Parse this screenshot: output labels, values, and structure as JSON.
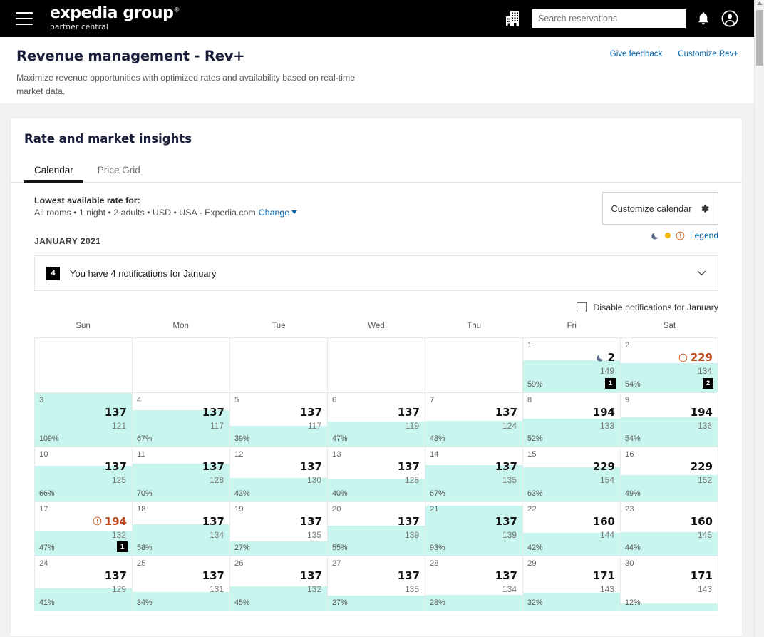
{
  "topnav": {
    "menu_icon": "hamburger-icon",
    "brand_main": "expedia group",
    "brand_reg": "®",
    "brand_sub": "partner central",
    "hotel_icon": "building-icon",
    "search_placeholder": "Search reservations",
    "search_value": "",
    "bell_icon": "bell-icon",
    "account_icon": "account-circle-icon"
  },
  "page": {
    "title": "Revenue management - Rev+",
    "subtitle": "Maximize revenue opportunities with optimized rates and availability based on real-time market data.",
    "give_feedback": "Give feedback",
    "customize_rev": "Customize Rev+"
  },
  "card": {
    "title": "Rate and market insights",
    "tabs": [
      {
        "label": "Calendar",
        "active": true
      },
      {
        "label": "Price Grid",
        "active": false
      }
    ],
    "rate_label": "Lowest available rate for:",
    "rate_value": "All rooms • 1 night • 2 adults • USD • USA - Expedia.com",
    "rate_change": "Change",
    "customize_calendar": "Customize calendar",
    "gear_icon": "gear-icon",
    "legend": {
      "moon_icon": "moon-icon",
      "dot_icon": "yellow-dot-icon",
      "warning_icon": "warning-circle-icon",
      "label": "Legend"
    }
  },
  "calendar": {
    "month_label": "JANUARY 2021",
    "notification": {
      "count": "4",
      "text": "You have 4 notifications for January",
      "chevron_icon": "chevron-down-icon"
    },
    "disable_notifications_label": "Disable notifications for January",
    "disable_notifications_checked": false,
    "weekdays": [
      "Sun",
      "Mon",
      "Tue",
      "Wed",
      "Thu",
      "Fri",
      "Sat"
    ],
    "accent_teal": "#c9f5ef",
    "alert_orange": "#c0461b",
    "cells": [
      {
        "empty": true
      },
      {
        "empty": true
      },
      {
        "empty": true
      },
      {
        "empty": true
      },
      {
        "empty": true
      },
      {
        "date": "1",
        "rate": "2",
        "market": "149",
        "occupancy": "59%",
        "badge": "1",
        "icon": "moon",
        "alert": false
      },
      {
        "date": "2",
        "rate": "229",
        "market": "134",
        "occupancy": "54%",
        "badge": "2",
        "icon": "warn",
        "alert": true
      },
      {
        "date": "3",
        "rate": "137",
        "market": "121",
        "occupancy": "109%",
        "badge": null,
        "icon": null,
        "alert": false
      },
      {
        "date": "4",
        "rate": "137",
        "market": "117",
        "occupancy": "67%",
        "badge": null,
        "icon": null,
        "alert": false
      },
      {
        "date": "5",
        "rate": "137",
        "market": "117",
        "occupancy": "39%",
        "badge": null,
        "icon": null,
        "alert": false
      },
      {
        "date": "6",
        "rate": "137",
        "market": "119",
        "occupancy": "47%",
        "badge": null,
        "icon": null,
        "alert": false
      },
      {
        "date": "7",
        "rate": "137",
        "market": "124",
        "occupancy": "48%",
        "badge": null,
        "icon": null,
        "alert": false
      },
      {
        "date": "8",
        "rate": "194",
        "market": "133",
        "occupancy": "52%",
        "badge": null,
        "icon": null,
        "alert": false
      },
      {
        "date": "9",
        "rate": "194",
        "market": "136",
        "occupancy": "54%",
        "badge": null,
        "icon": null,
        "alert": false
      },
      {
        "date": "10",
        "rate": "137",
        "market": "125",
        "occupancy": "66%",
        "badge": null,
        "icon": null,
        "alert": false
      },
      {
        "date": "11",
        "rate": "137",
        "market": "128",
        "occupancy": "70%",
        "badge": null,
        "icon": null,
        "alert": false
      },
      {
        "date": "12",
        "rate": "137",
        "market": "130",
        "occupancy": "43%",
        "badge": null,
        "icon": null,
        "alert": false
      },
      {
        "date": "13",
        "rate": "137",
        "market": "128",
        "occupancy": "40%",
        "badge": null,
        "icon": null,
        "alert": false
      },
      {
        "date": "14",
        "rate": "137",
        "market": "135",
        "occupancy": "67%",
        "badge": null,
        "icon": null,
        "alert": false
      },
      {
        "date": "15",
        "rate": "229",
        "market": "154",
        "occupancy": "63%",
        "badge": null,
        "icon": null,
        "alert": false
      },
      {
        "date": "16",
        "rate": "229",
        "market": "152",
        "occupancy": "49%",
        "badge": null,
        "icon": null,
        "alert": false
      },
      {
        "date": "17",
        "rate": "194",
        "market": "132",
        "occupancy": "47%",
        "badge": "1",
        "icon": "warn",
        "alert": true
      },
      {
        "date": "18",
        "rate": "137",
        "market": "134",
        "occupancy": "58%",
        "badge": null,
        "icon": null,
        "alert": false
      },
      {
        "date": "19",
        "rate": "137",
        "market": "135",
        "occupancy": "27%",
        "badge": null,
        "icon": null,
        "alert": false
      },
      {
        "date": "20",
        "rate": "137",
        "market": "139",
        "occupancy": "55%",
        "badge": null,
        "icon": null,
        "alert": false
      },
      {
        "date": "21",
        "rate": "137",
        "market": "139",
        "occupancy": "93%",
        "badge": null,
        "icon": null,
        "alert": false
      },
      {
        "date": "22",
        "rate": "160",
        "market": "144",
        "occupancy": "42%",
        "badge": null,
        "icon": null,
        "alert": false
      },
      {
        "date": "23",
        "rate": "160",
        "market": "145",
        "occupancy": "44%",
        "badge": null,
        "icon": null,
        "alert": false
      },
      {
        "date": "24",
        "rate": "137",
        "market": "129",
        "occupancy": "41%",
        "badge": null,
        "icon": null,
        "alert": false
      },
      {
        "date": "25",
        "rate": "137",
        "market": "131",
        "occupancy": "34%",
        "badge": null,
        "icon": null,
        "alert": false
      },
      {
        "date": "26",
        "rate": "137",
        "market": "132",
        "occupancy": "45%",
        "badge": null,
        "icon": null,
        "alert": false
      },
      {
        "date": "27",
        "rate": "137",
        "market": "135",
        "occupancy": "27%",
        "badge": null,
        "icon": null,
        "alert": false
      },
      {
        "date": "28",
        "rate": "137",
        "market": "134",
        "occupancy": "28%",
        "badge": null,
        "icon": null,
        "alert": false
      },
      {
        "date": "29",
        "rate": "171",
        "market": "143",
        "occupancy": "32%",
        "badge": null,
        "icon": null,
        "alert": false
      },
      {
        "date": "30",
        "rate": "171",
        "market": "143",
        "occupancy": "12%",
        "badge": null,
        "icon": null,
        "alert": false
      }
    ]
  }
}
